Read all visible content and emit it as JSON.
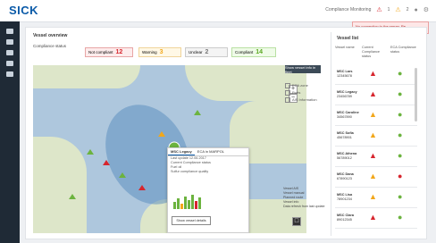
{
  "header": {
    "logo": "SICK",
    "context": "Compliance Monitoring",
    "counts": {
      "red": "1",
      "yellow": "2"
    },
    "icons": [
      "alarm-icon",
      "warning-icon",
      "user-icon",
      "gear-icon"
    ]
  },
  "alert": {
    "text": "No connection to the server. Re-connecting..."
  },
  "main": {
    "title": "Vessel overview",
    "compliance_label": "Compliance status",
    "badges": [
      {
        "label": "Not compliant",
        "value": "12"
      },
      {
        "label": "Warning",
        "value": "3"
      },
      {
        "label": "Unclear",
        "value": "2"
      },
      {
        "label": "Compliant",
        "value": "14"
      }
    ]
  },
  "map": {
    "vessel_panel_button": "Show vessel info in fleet",
    "layers": [
      "ECA zone",
      "Ports",
      "AIS Information"
    ],
    "legend": [
      "Vessel AIS",
      "Vessel manual",
      "Planned route",
      "Vessel info",
      "Data refresh from last update"
    ],
    "popup": {
      "tabs": [
        "MSC Legacy",
        "ECA in MARPOL"
      ],
      "lines": [
        "Last update 12.06.2017",
        "Current Compliance status",
        "Fuel oil",
        "Sulfur compliance quality"
      ],
      "button": "Show vessel details"
    }
  },
  "vessel_list": {
    "title": "Vessel list",
    "headers": [
      "Vessel name",
      "Current Compliance status",
      "ECA Compliance status"
    ],
    "rows": [
      {
        "name": "MSC Lars",
        "imo": "12345678",
        "a": "red",
        "b": "green"
      },
      {
        "name": "MSC Legacy",
        "imo": "23456789",
        "a": "red",
        "b": "green"
      },
      {
        "name": "MSC Caroline",
        "imo": "34567890",
        "a": "yellow",
        "b": "green"
      },
      {
        "name": "MSC Sofia",
        "imo": "45678901",
        "a": "yellow",
        "b": "green"
      },
      {
        "name": "MSC Athena",
        "imo": "56789012",
        "a": "red",
        "b": "green"
      },
      {
        "name": "MSC Dana",
        "imo": "67890123",
        "a": "yellow",
        "b": "red"
      },
      {
        "name": "MSC Lisa",
        "imo": "78901234",
        "a": "yellow",
        "b": "green"
      },
      {
        "name": "MSC Clara",
        "imo": "89012345",
        "a": "red",
        "b": "green"
      }
    ]
  },
  "colors": {
    "red": "#d7262e",
    "yellow": "#f2a71b",
    "green": "#6cb33f",
    "brand": "#0a5aa8"
  }
}
